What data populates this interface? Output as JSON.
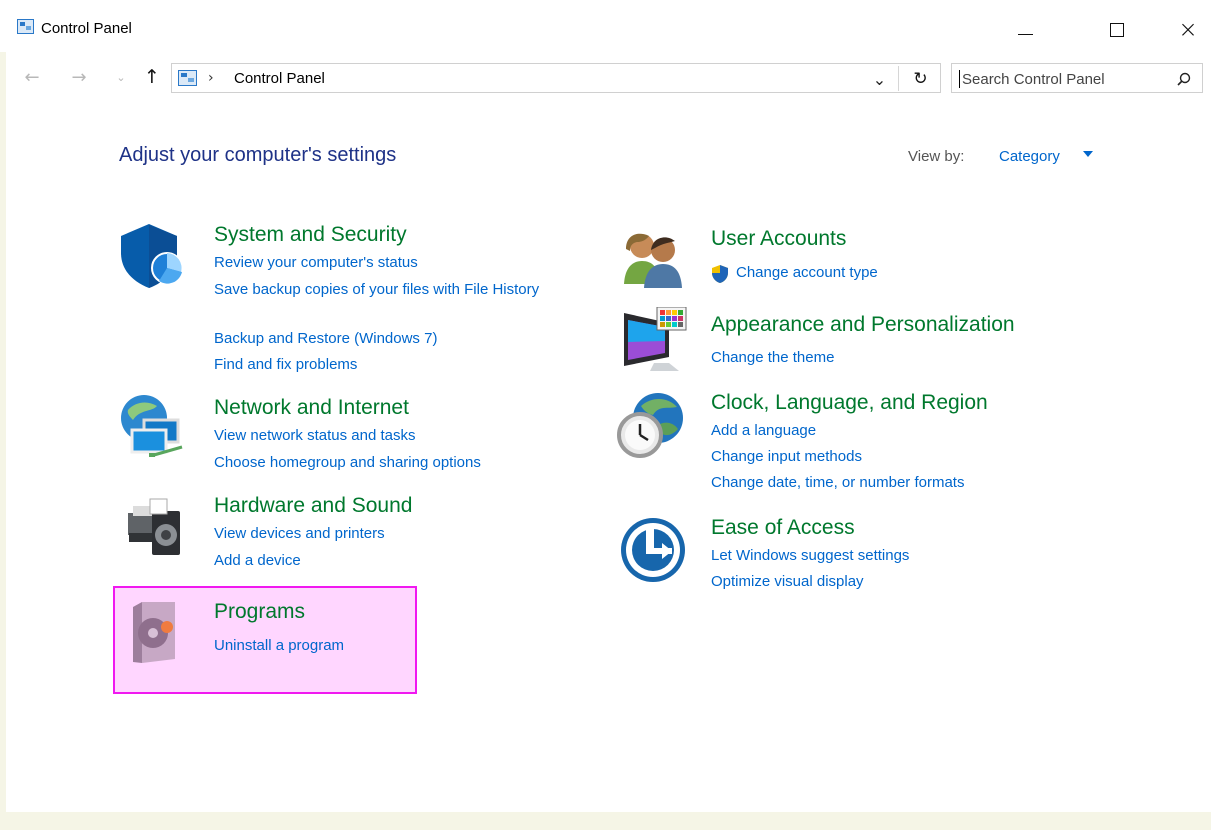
{
  "window": {
    "title": "Control Panel"
  },
  "navigation": {
    "back_label": "←",
    "forward_label": "→",
    "recent_label": "⌄",
    "up_label": "↑",
    "address": {
      "separator": "›",
      "location": "Control Panel"
    },
    "search": {
      "placeholder": "Search Control Panel"
    }
  },
  "main": {
    "title": "Adjust your computer's settings",
    "view_by": {
      "label": "View by:",
      "value": "Category"
    }
  },
  "categories": [
    {
      "title": "System and Security",
      "links": [
        "Review your computer's status",
        "Save backup copies of your files with File History",
        "Backup and Restore (Windows 7)",
        "Find and fix problems"
      ]
    },
    {
      "title": "Network and Internet",
      "links": [
        "View network status and tasks",
        "Choose homegroup and sharing options"
      ]
    },
    {
      "title": "Hardware and Sound",
      "links": [
        "View devices and printers",
        "Add a device"
      ]
    },
    {
      "title": "Programs",
      "links": [
        "Uninstall a program"
      ],
      "highlighted": true
    },
    {
      "title": "User Accounts",
      "links": [
        "Change account type"
      ]
    },
    {
      "title": "Appearance and Personalization",
      "links": [
        "Change the theme"
      ]
    },
    {
      "title": "Clock, Language, and Region",
      "links": [
        "Add a language",
        "Change input methods",
        "Change date, time, or number formats"
      ]
    },
    {
      "title": "Ease of Access",
      "links": [
        "Let Windows suggest settings",
        "Optimize visual display"
      ]
    }
  ],
  "colors": {
    "category_title": "#00782d",
    "link": "#0066cc",
    "page_title": "#1e3287",
    "highlight_fill": "#ffd6ff",
    "highlight_border": "#f018f0"
  },
  "icons": {
    "app": "control-panel-icon",
    "system_security": "shield-icon",
    "network": "globe-network-icon",
    "hardware": "printer-speaker-icon",
    "programs": "software-box-icon",
    "users": "users-icon",
    "appearance": "monitor-color-icon",
    "clock": "globe-clock-icon",
    "ease": "ease-of-access-icon",
    "uac": "uac-shield-icon"
  }
}
